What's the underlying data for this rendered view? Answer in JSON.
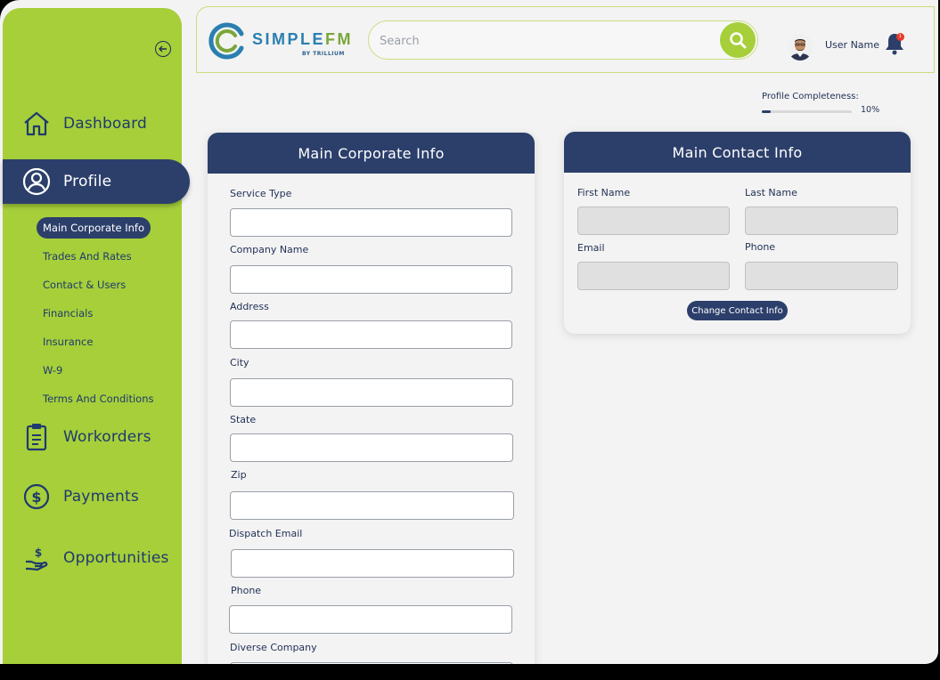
{
  "brand": {
    "name_a": "SIMPLE",
    "name_b": "FM",
    "tagline": "BY TRILLIUM"
  },
  "search": {
    "placeholder": "Search"
  },
  "user": {
    "name": "User Name",
    "notification_count": "1"
  },
  "completeness": {
    "label": "Profile Completeness:",
    "value": "10%",
    "fraction": 0.1
  },
  "sidebar": {
    "dashboard": "Dashboard",
    "profile": "Profile",
    "sub": [
      "Main Corporate Info",
      "Trades And Rates",
      "Contact & Users",
      "Financials",
      "Insurance",
      "W-9",
      "Terms And Conditions"
    ],
    "workorders": "Workorders",
    "payments": "Payments",
    "opportunities": "Opportunities"
  },
  "corporate": {
    "title": "Main Corporate Info",
    "fields": [
      "Service Type",
      "Company Name",
      "Address",
      "City",
      "State",
      "Zip",
      "Dispatch Email",
      "Phone",
      "Diverse Company"
    ]
  },
  "contact": {
    "title": "Main Contact Info",
    "first_name": "First Name",
    "last_name": "Last Name",
    "email": "Email",
    "phone": "Phone",
    "button": "Change Contact Info"
  },
  "colors": {
    "sidebar": "#a6cf3a",
    "navy": "#2c3f6b",
    "accent": "#a6cf3a"
  }
}
